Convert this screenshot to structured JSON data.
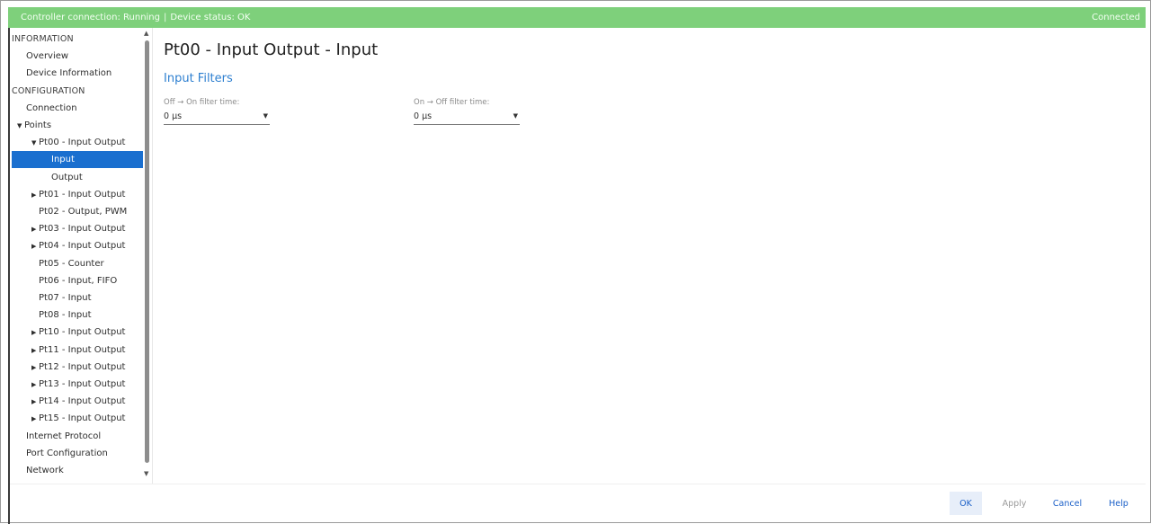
{
  "status_bar": {
    "controller_connection": "Controller connection: Running",
    "device_status": "Device status: OK",
    "connection_state": "Connected"
  },
  "sidebar": {
    "items": [
      {
        "label": "INFORMATION",
        "kind": "section"
      },
      {
        "label": "Overview",
        "kind": "item"
      },
      {
        "label": "Device Information",
        "kind": "item"
      },
      {
        "label": "CONFIGURATION",
        "kind": "section"
      },
      {
        "label": "Connection",
        "kind": "item"
      },
      {
        "label": "Points",
        "kind": "expanded"
      },
      {
        "label": "Pt00 - Input Output",
        "kind": "expanded"
      },
      {
        "label": "Input",
        "kind": "selected"
      },
      {
        "label": "Output",
        "kind": "item"
      },
      {
        "label": "Pt01 - Input Output",
        "kind": "collapsed"
      },
      {
        "label": "Pt02 - Output, PWM",
        "kind": "item"
      },
      {
        "label": "Pt03 - Input Output",
        "kind": "collapsed"
      },
      {
        "label": "Pt04 - Input Output",
        "kind": "collapsed"
      },
      {
        "label": "Pt05 - Counter",
        "kind": "item"
      },
      {
        "label": "Pt06 - Input, FIFO",
        "kind": "item"
      },
      {
        "label": "Pt07 - Input",
        "kind": "item"
      },
      {
        "label": "Pt08 - Input",
        "kind": "item"
      },
      {
        "label": "Pt10 - Input Output",
        "kind": "collapsed"
      },
      {
        "label": "Pt11 - Input Output",
        "kind": "collapsed"
      },
      {
        "label": "Pt12 - Input Output",
        "kind": "collapsed"
      },
      {
        "label": "Pt13 - Input Output",
        "kind": "collapsed"
      },
      {
        "label": "Pt14 - Input Output",
        "kind": "collapsed"
      },
      {
        "label": "Pt15 - Input Output",
        "kind": "collapsed"
      },
      {
        "label": "Internet Protocol",
        "kind": "item"
      },
      {
        "label": "Port Configuration",
        "kind": "item"
      },
      {
        "label": "Network",
        "kind": "item"
      }
    ]
  },
  "main": {
    "title": "Pt00 - Input Output - Input",
    "section_title": "Input Filters",
    "fields": {
      "off_on": {
        "label": "Off → On filter time:",
        "value": "0 µs"
      },
      "on_off": {
        "label": "On → Off filter time:",
        "value": "0 µs"
      }
    }
  },
  "footer": {
    "ok_label": "OK",
    "apply_label": "Apply",
    "cancel_label": "Cancel",
    "help_label": "Help"
  },
  "colors": {
    "status_bar_bg": "#7ed07b",
    "selection_bg": "#1a6fcf",
    "accent": "#2d7fd0"
  },
  "icons": {
    "expanded": "triangle-down-icon",
    "collapsed": "triangle-right-icon",
    "dropdown": "chevron-down-icon"
  }
}
